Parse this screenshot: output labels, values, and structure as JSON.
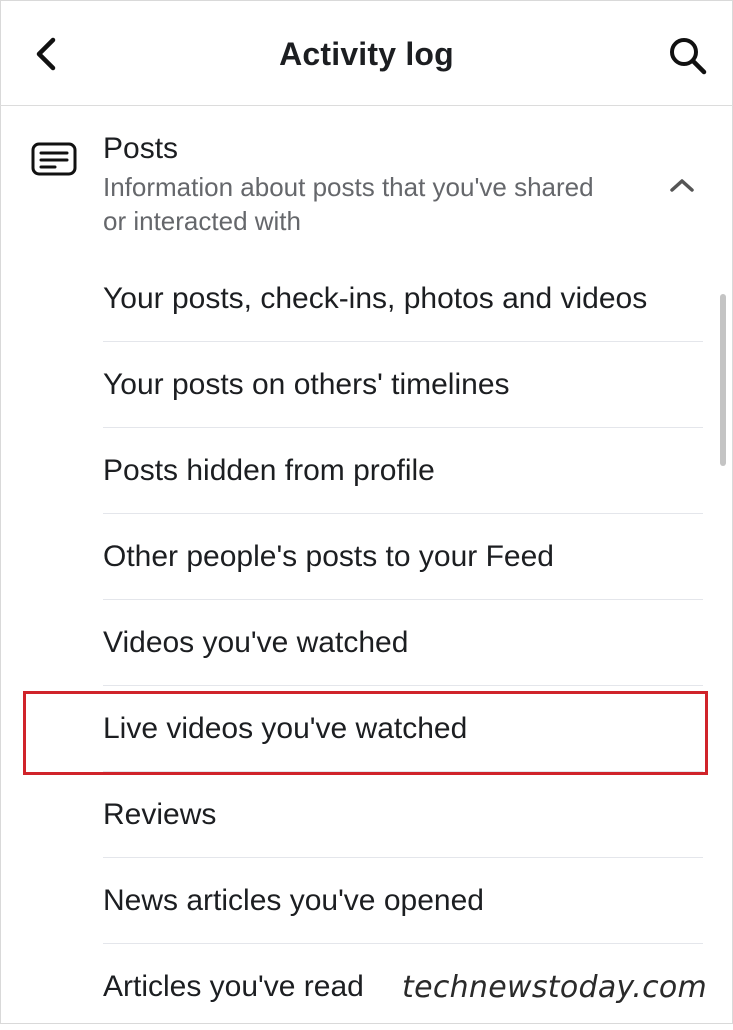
{
  "header": {
    "title": "Activity log",
    "back_icon": "chevron-left-icon",
    "search_icon": "search-icon"
  },
  "section": {
    "title": "Posts",
    "description": "Information about posts that you've shared or interacted with",
    "icon": "post-list-icon",
    "toggle_icon": "chevron-up-icon"
  },
  "items": [
    {
      "label": "Your posts, check-ins, photos and videos"
    },
    {
      "label": "Your posts on others' timelines"
    },
    {
      "label": "Posts hidden from profile"
    },
    {
      "label": "Other people's posts to your Feed"
    },
    {
      "label": "Videos you've watched"
    },
    {
      "label": "Live videos you've watched",
      "highlighted": true
    },
    {
      "label": "Reviews"
    },
    {
      "label": "News articles you've opened"
    },
    {
      "label": "Articles you've read"
    }
  ],
  "highlight_color": "#d0232a",
  "watermark": "technewstoday.com"
}
